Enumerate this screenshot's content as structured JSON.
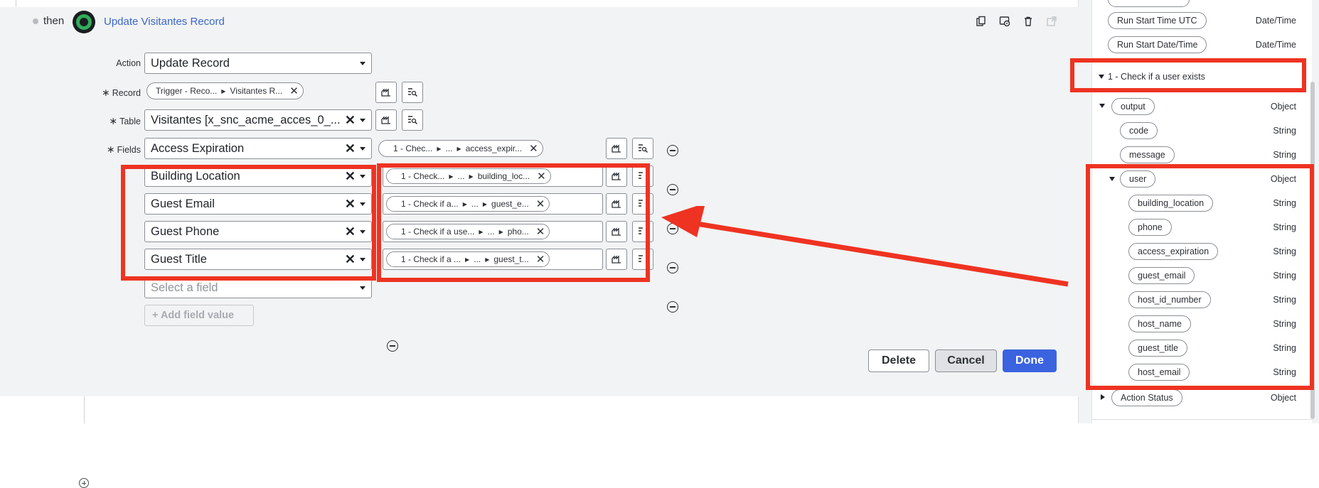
{
  "step": {
    "connector_label": "then",
    "title": "Update Visitantes Record",
    "header_icons": [
      "copy-icon",
      "settings-icon",
      "trash-icon",
      "open-external-icon"
    ]
  },
  "form": {
    "action": {
      "label": "Action",
      "value": "Update Record"
    },
    "record": {
      "label": "Record",
      "pill": {
        "part1": "Trigger - Reco...",
        "part2": "Visitantes R..."
      }
    },
    "table": {
      "label": "Table",
      "value": "Visitantes [x_snc_acme_acces_0_..."
    },
    "fields_label": "Fields",
    "rows": [
      {
        "field": "Access Expiration",
        "pill": {
          "a": "1 - Chec...",
          "b": "...",
          "c": "access_expir..."
        }
      },
      {
        "field": "Building Location",
        "pill": {
          "a": "1 - Check...",
          "b": "...",
          "c": "building_loc..."
        }
      },
      {
        "field": "Guest Email",
        "pill": {
          "a": "1 - Check if a...",
          "b": "...",
          "c": "guest_e..."
        }
      },
      {
        "field": "Guest Phone",
        "pill": {
          "a": "1 - Check if a use...",
          "b": "...",
          "c": "pho..."
        }
      },
      {
        "field": "Guest Title",
        "pill": {
          "a": "1 - Check if a ...",
          "b": "...",
          "c": "guest_t..."
        }
      }
    ],
    "select_placeholder": "Select a field",
    "add_field_value": "+ Add field value"
  },
  "buttons": {
    "delete": "Delete",
    "cancel": "Cancel",
    "done": "Done"
  },
  "data_panel": {
    "top_items": [
      {
        "label": "Run Start Time UTC",
        "type": "Date/Time"
      },
      {
        "label": "Run Start Date/Time",
        "type": "Date/Time"
      }
    ],
    "section_title": "1 - Check if a user exists",
    "output": {
      "label": "output",
      "type": "Object"
    },
    "output_children": [
      {
        "label": "code",
        "type": "String"
      },
      {
        "label": "message",
        "type": "String"
      }
    ],
    "user": {
      "label": "user",
      "type": "Object"
    },
    "user_children": [
      {
        "label": "building_location",
        "type": "String"
      },
      {
        "label": "phone",
        "type": "String"
      },
      {
        "label": "access_expiration",
        "type": "String"
      },
      {
        "label": "guest_email",
        "type": "String"
      },
      {
        "label": "host_id_number",
        "type": "String"
      },
      {
        "label": "host_name",
        "type": "String"
      },
      {
        "label": "guest_title",
        "type": "String"
      },
      {
        "label": "host_email",
        "type": "String"
      }
    ],
    "action_status": {
      "label": "Action Status",
      "type": "Object"
    }
  },
  "colors": {
    "annotation": "#ee3322",
    "accent": "#3b63e0",
    "link": "#3a67c9"
  }
}
